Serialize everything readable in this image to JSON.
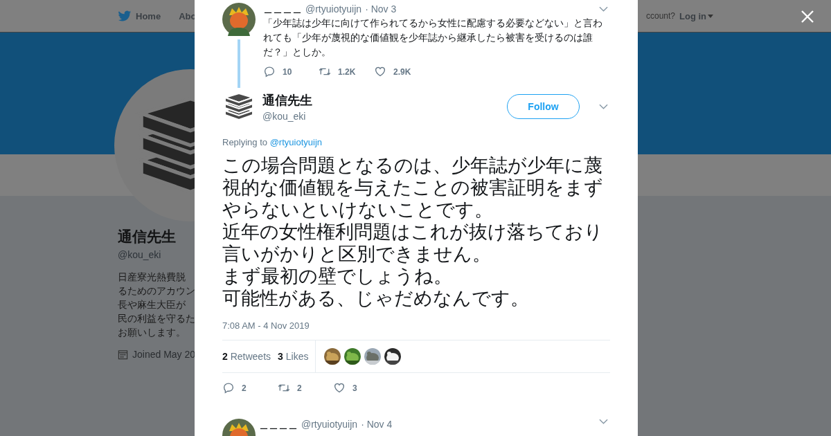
{
  "background_page": {
    "nav": {
      "home": "Home",
      "about": "Abo",
      "account_prompt": "ccount?",
      "login": "Log in"
    },
    "profile": {
      "name": "通信先生",
      "handle": "@kou_eki",
      "bio_lines": [
        "日産寮光熱費脱",
        "るためのアカウン",
        "長や麻生大臣が",
        "民の利益を守るた",
        "お願いします。"
      ],
      "joined": "Joined May 20"
    }
  },
  "modal": {
    "parent_tweet": {
      "name": "＿＿＿＿",
      "handle": "@rtyuiotyuijn",
      "date": "· Nov 3",
      "text": "「少年誌は少年に向けて作られてるから女性に配慮する必要などない」と言われても「少年が蔑視的な価値観を少年誌から継承したら被害を受けるのは誰だ？」としか。",
      "actions": [
        {
          "kind": "reply",
          "count": "10"
        },
        {
          "kind": "retweet",
          "count": "1.2K"
        },
        {
          "kind": "like",
          "count": "2.9K"
        }
      ]
    },
    "tweet": {
      "name": "通信先生",
      "handle": "@kou_eki",
      "follow": "Follow",
      "replying_label": "Replying to",
      "replying_to": "@rtyuiotyuijn",
      "paragraphs": [
        "この場合問題となるのは、少年誌が少年に蔑視的な価値観を与えたことの被害証明をまずやらないといけないことです。",
        "近年の女性権利問題はこれが抜け落ちており言いがかりと区別できません。",
        "まず最初の壁でしょうね。",
        "可能性がある、じゃだめなんです。"
      ],
      "timestamp": "7:08 AM - 4 Nov 2019",
      "stats": [
        {
          "count": "2",
          "label": "Retweets"
        },
        {
          "count": "3",
          "label": "Likes"
        }
      ],
      "likers": [
        {
          "kind": "picture"
        },
        {
          "kind": "picture"
        },
        {
          "kind": "picture"
        },
        {
          "kind": "picture"
        }
      ],
      "actions": [
        {
          "kind": "reply",
          "count": "2"
        },
        {
          "kind": "retweet",
          "count": "2"
        },
        {
          "kind": "like",
          "count": "3"
        }
      ]
    },
    "next_tweet": {
      "name": "＿＿＿＿",
      "handle": "@rtyuiotyuijn",
      "date": "· Nov 4"
    }
  }
}
